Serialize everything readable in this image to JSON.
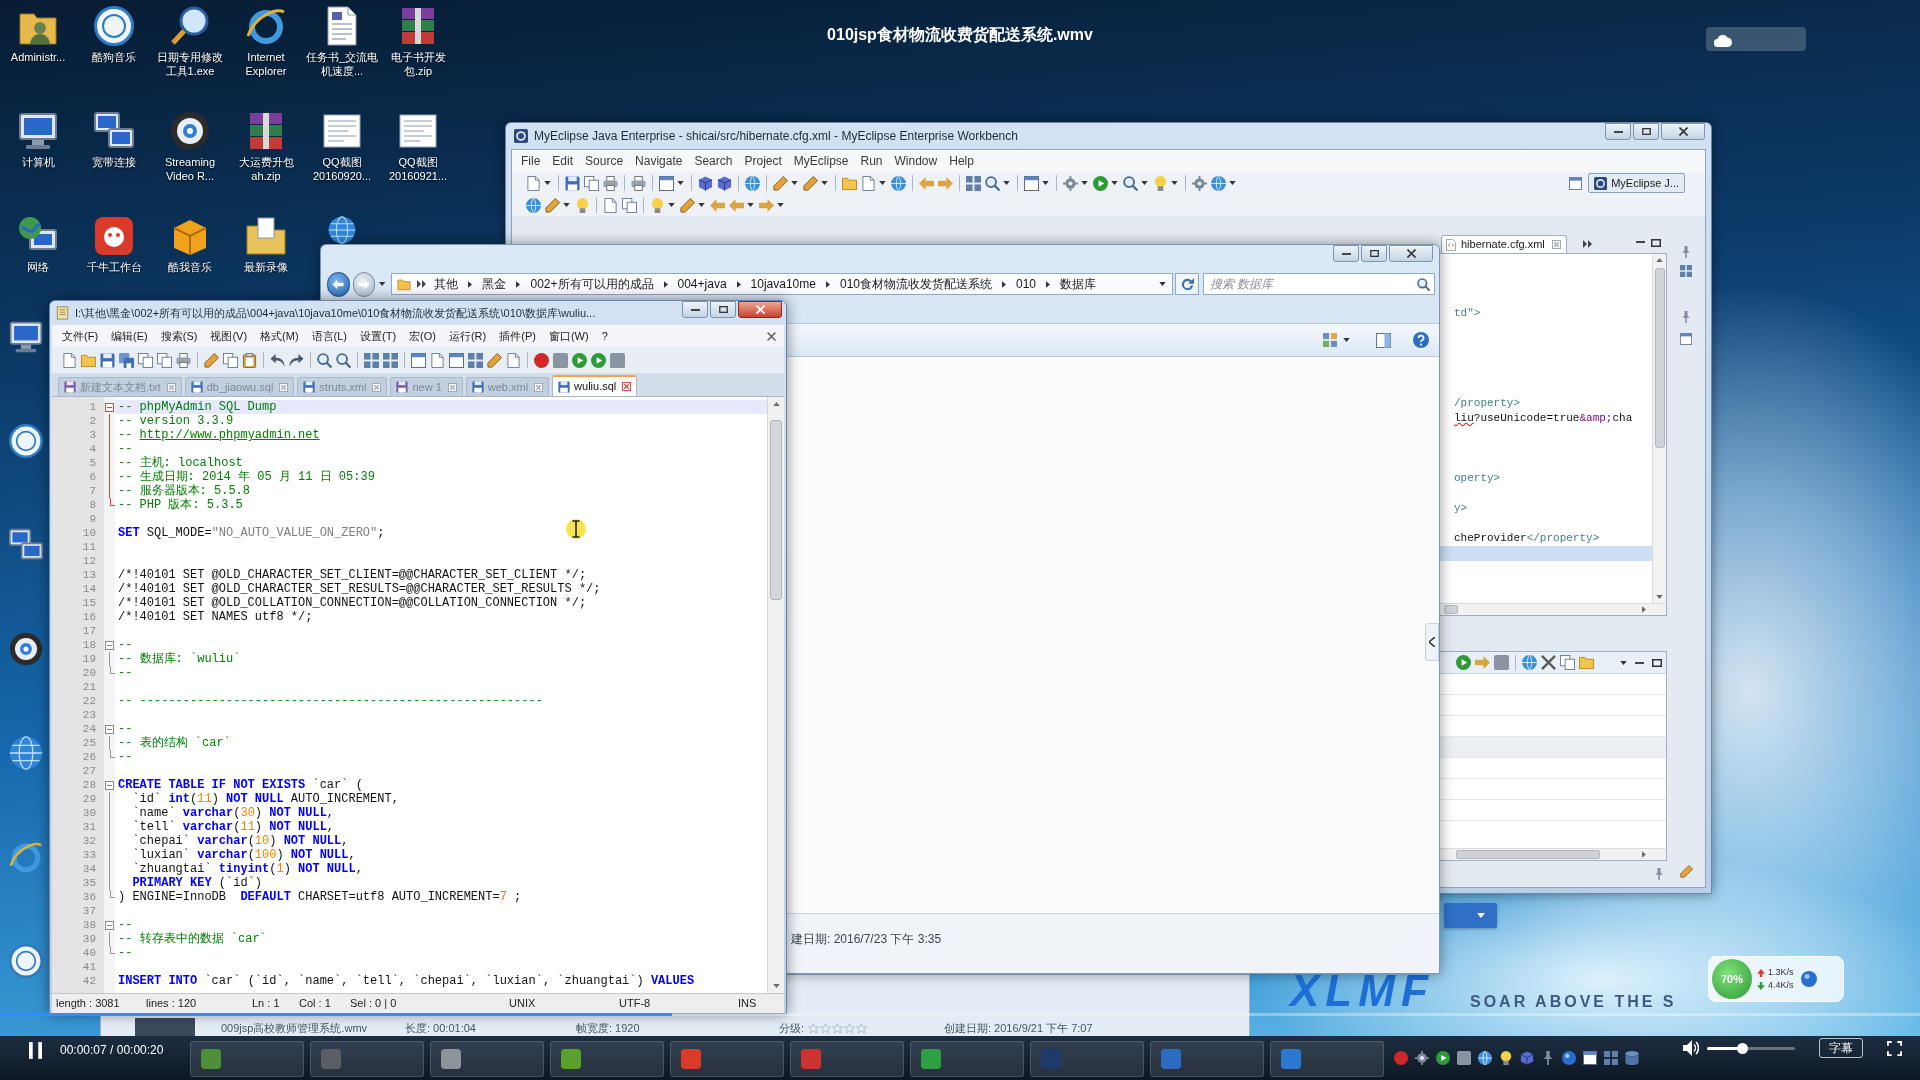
{
  "player": {
    "title": "010jsp食材物流收费货配送系统.wmv",
    "playing": true,
    "progress": {
      "level": 0.35
    },
    "time": "00:00:07 / 00:00:20",
    "volume": {
      "level": 0.4
    },
    "subtitle_button": "字幕"
  },
  "desktop_icons": [
    {
      "label": "Administr...",
      "kind": "user-folder"
    },
    {
      "label": "酷狗音乐",
      "kind": "ring"
    },
    {
      "label": "日期专用修改工具1.exe",
      "kind": "magnifier"
    },
    {
      "label": "Internet Explorer",
      "kind": "orbit"
    },
    {
      "label": "任务书_交流电机速度...",
      "kind": "document"
    },
    {
      "label": "电子书开发包.zip",
      "kind": "books"
    },
    {
      "label": "计算机",
      "kind": "monitor"
    },
    {
      "label": "宽带连接",
      "kind": "monitors"
    },
    {
      "label": "Streaming Video R...",
      "kind": "disc"
    },
    {
      "label": "大运费升包ah.zip",
      "kind": "books"
    },
    {
      "label": "QQ截图20160920...",
      "kind": "thumbnail"
    },
    {
      "label": "QQ截图20160921...",
      "kind": "thumbnail"
    },
    {
      "label": "网络",
      "kind": "globe-monitor"
    },
    {
      "label": "千牛工作台",
      "kind": "app-tile"
    },
    {
      "label": "酷我音乐",
      "kind": "box"
    },
    {
      "label": "最新录像",
      "kind": "doc-folder"
    },
    {
      "kind": "globe"
    }
  ],
  "desktop_edge_icons": [
    {
      "kind": "monitor"
    },
    {
      "kind": "ring"
    },
    {
      "kind": "monitors"
    },
    {
      "kind": "disc"
    },
    {
      "kind": "globe"
    },
    {
      "kind": "orbit"
    },
    {
      "kind": "ring"
    }
  ],
  "eclipse": {
    "title": "MyEclipse Java Enterprise - shicai/src/hibernate.cfg.xml - MyEclipse Enterprise Workbench",
    "menu": [
      "File",
      "Edit",
      "Source",
      "Navigate",
      "Search",
      "Project",
      "MyEclipse",
      "Run",
      "Window",
      "Help"
    ],
    "perspective": "MyEclipse J...",
    "editor_tab": "hibernate.cfg.xml",
    "lines": [
      {
        "current": false
      },
      {
        "current": false
      },
      {
        "current": false
      },
      {
        "current": false,
        "segments": [
          {
            "kind": "tag",
            "text": "td\">"
          }
        ]
      },
      {
        "current": false
      },
      {
        "current": false
      },
      {
        "current": false
      },
      {
        "current": false
      },
      {
        "current": false
      },
      {
        "current": false,
        "segments": [
          {
            "kind": "tag",
            "text": "/property>"
          }
        ]
      },
      {
        "current": false,
        "segments": [
          {
            "kind": "misspelled",
            "text": "liu"
          },
          {
            "kind": "plain",
            "text": "?useUnicode=true"
          },
          {
            "kind": "entity",
            "text": "&amp;"
          },
          {
            "kind": "plain",
            "text": "cha"
          }
        ]
      },
      {
        "current": false
      },
      {
        "current": false
      },
      {
        "current": false
      },
      {
        "current": false,
        "segments": [
          {
            "kind": "tag",
            "text": "operty>"
          }
        ]
      },
      {
        "current": false
      },
      {
        "current": false,
        "segments": [
          {
            "kind": "tag",
            "text": "y>"
          }
        ]
      },
      {
        "current": false
      },
      {
        "current": false,
        "segments": [
          {
            "kind": "plain",
            "text": "cheProvider"
          },
          {
            "kind": "tag",
            "text": "</property>"
          }
        ]
      },
      {
        "current": true
      },
      {
        "current": false
      },
      {
        "current": false
      },
      {
        "current": false
      }
    ]
  },
  "explorer": {
    "breadcrumb": [
      "其他",
      "黑金",
      "002+所有可以用的成品",
      "004+java",
      "10java10me",
      "010食材物流收发货配送系统",
      "010",
      "数据库"
    ],
    "search": {
      "placeholder": "搜索 数据库"
    },
    "details": "建日期: 2016/7/23 下午 3:35"
  },
  "notepad": {
    "title": "I:\\其他\\黑金\\002+所有可以用的成品\\004+java\\10java10me\\010食材物流收发货配送系统\\010\\数据库\\wuliu...",
    "menu": [
      "文件(F)",
      "编辑(E)",
      "搜索(S)",
      "视图(V)",
      "格式(M)",
      "语言(L)",
      "设置(T)",
      "宏(O)",
      "运行(R)",
      "插件(P)",
      "窗口(W)",
      "?"
    ],
    "tabs": [
      {
        "label": "新建文本文档.txt",
        "selected": false
      },
      {
        "label": "db_jiaowu.sql",
        "selected": false
      },
      {
        "label": "struts.xml",
        "selected": false
      },
      {
        "label": "new 1",
        "selected": false
      },
      {
        "label": "web.xml",
        "selected": false
      },
      {
        "label": "wuliu.sql",
        "selected": true
      }
    ],
    "lines": [
      {
        "number": "1",
        "current": true,
        "expanded": true,
        "segments": [
          {
            "kind": "comment",
            "text": "-- phpMyAdmin SQL Dump"
          }
        ],
        "children": [
          {
            "number": "2",
            "current": false,
            "segments": [
              {
                "kind": "comment",
                "text": "-- version 3.3.9"
              }
            ]
          },
          {
            "number": "3",
            "current": false,
            "segments": [
              {
                "kind": "comment",
                "text": "-- "
              },
              {
                "kind": "link",
                "text": "http://www.phpmyadmin.net"
              }
            ]
          },
          {
            "number": "4",
            "current": false,
            "segments": [
              {
                "kind": "comment",
                "text": "--"
              }
            ]
          },
          {
            "number": "5",
            "current": false,
            "segments": [
              {
                "kind": "comment",
                "text": "-- 主机: localhost"
              }
            ]
          },
          {
            "number": "6",
            "current": false,
            "segments": [
              {
                "kind": "comment",
                "text": "-- 生成日期: 2014 年 05 月 11 日 05:39"
              }
            ]
          },
          {
            "number": "7",
            "current": false,
            "segments": [
              {
                "kind": "comment",
                "text": "-- 服务器版本: 5.5.8"
              }
            ]
          },
          {
            "number": "8",
            "current": false,
            "segments": [
              {
                "kind": "comment",
                "text": "-- PHP 版本: 5.3.5"
              }
            ]
          }
        ]
      },
      {
        "number": "9",
        "current": false
      },
      {
        "number": "10",
        "current": false,
        "segments": [
          {
            "kind": "keyword",
            "text": "SET"
          },
          {
            "kind": "plain",
            "text": " SQL_MODE="
          },
          {
            "kind": "string",
            "text": "\"NO_AUTO_VALUE_ON_ZERO\""
          },
          {
            "kind": "plain",
            "text": ";"
          }
        ]
      },
      {
        "number": "11",
        "current": false
      },
      {
        "number": "12",
        "current": false
      },
      {
        "number": "13",
        "current": false,
        "segments": [
          {
            "kind": "plain",
            "text": "/*!40101 SET @OLD_CHARACTER_SET_CLIENT=@@CHARACTER_SET_CLIENT */;"
          }
        ]
      },
      {
        "number": "14",
        "current": false,
        "segments": [
          {
            "kind": "plain",
            "text": "/*!40101 SET @OLD_CHARACTER_SET_RESULTS=@@CHARACTER_SET_RESULTS */;"
          }
        ]
      },
      {
        "number": "15",
        "current": false,
        "segments": [
          {
            "kind": "plain",
            "text": "/*!40101 SET @OLD_COLLATION_CONNECTION=@@COLLATION_CONNECTION */;"
          }
        ]
      },
      {
        "number": "16",
        "current": false,
        "segments": [
          {
            "kind": "plain",
            "text": "/*!40101 SET NAMES utf8 */;"
          }
        ]
      },
      {
        "number": "17",
        "current": false
      },
      {
        "number": "18",
        "current": false,
        "expanded": true,
        "segments": [
          {
            "kind": "comment",
            "text": "--"
          }
        ],
        "children": [
          {
            "number": "19",
            "current": false,
            "segments": [
              {
                "kind": "comment",
                "text": "-- 数据库: `wuliu`"
              }
            ]
          },
          {
            "number": "20",
            "current": false,
            "segments": [
              {
                "kind": "comment",
                "text": "--"
              }
            ]
          }
        ]
      },
      {
        "number": "21",
        "current": false
      },
      {
        "number": "22",
        "current": false,
        "segments": [
          {
            "kind": "comment",
            "text": "-- --------------------------------------------------------"
          }
        ]
      },
      {
        "number": "23",
        "current": false
      },
      {
        "number": "24",
        "current": false,
        "expanded": true,
        "segments": [
          {
            "kind": "comment",
            "text": "--"
          }
        ],
        "children": [
          {
            "number": "25",
            "current": false,
            "segments": [
              {
                "kind": "comment",
                "text": "-- 表的结构 `car`"
              }
            ]
          },
          {
            "number": "26",
            "current": false,
            "segments": [
              {
                "kind": "comment",
                "text": "--"
              }
            ]
          }
        ]
      },
      {
        "number": "27",
        "current": false
      },
      {
        "number": "28",
        "current": false,
        "expanded": true,
        "segments": [
          {
            "kind": "keyword",
            "text": "CREATE TABLE IF NOT EXISTS"
          },
          {
            "kind": "plain",
            "text": " `car` ("
          }
        ],
        "children": [
          {
            "number": "29",
            "current": false,
            "segments": [
              {
                "kind": "plain",
                "text": "  `id` "
              },
              {
                "kind": "keyword",
                "text": "int"
              },
              {
                "kind": "plain",
                "text": "("
              },
              {
                "kind": "number",
                "text": "11"
              },
              {
                "kind": "plain",
                "text": ") "
              },
              {
                "kind": "keyword",
                "text": "NOT NULL"
              },
              {
                "kind": "plain",
                "text": " AUTO_INCREMENT,"
              }
            ]
          },
          {
            "number": "30",
            "current": false,
            "segments": [
              {
                "kind": "plain",
                "text": "  `name` "
              },
              {
                "kind": "keyword",
                "text": "varchar"
              },
              {
                "kind": "plain",
                "text": "("
              },
              {
                "kind": "number",
                "text": "30"
              },
              {
                "kind": "plain",
                "text": ") "
              },
              {
                "kind": "keyword",
                "text": "NOT NULL"
              },
              {
                "kind": "plain",
                "text": ","
              }
            ]
          },
          {
            "number": "31",
            "current": false,
            "segments": [
              {
                "kind": "plain",
                "text": "  `tell` "
              },
              {
                "kind": "keyword",
                "text": "varchar"
              },
              {
                "kind": "plain",
                "text": "("
              },
              {
                "kind": "number",
                "text": "11"
              },
              {
                "kind": "plain",
                "text": ") "
              },
              {
                "kind": "keyword",
                "text": "NOT NULL"
              },
              {
                "kind": "plain",
                "text": ","
              }
            ]
          },
          {
            "number": "32",
            "current": false,
            "segments": [
              {
                "kind": "plain",
                "text": "  `chepai` "
              },
              {
                "kind": "keyword",
                "text": "varchar"
              },
              {
                "kind": "plain",
                "text": "("
              },
              {
                "kind": "number",
                "text": "10"
              },
              {
                "kind": "plain",
                "text": ") "
              },
              {
                "kind": "keyword",
                "text": "NOT NULL"
              },
              {
                "kind": "plain",
                "text": ","
              }
            ]
          },
          {
            "number": "33",
            "current": false,
            "segments": [
              {
                "kind": "plain",
                "text": "  `luxian` "
              },
              {
                "kind": "keyword",
                "text": "varchar"
              },
              {
                "kind": "plain",
                "text": "("
              },
              {
                "kind": "number",
                "text": "100"
              },
              {
                "kind": "plain",
                "text": ") "
              },
              {
                "kind": "keyword",
                "text": "NOT NULL"
              },
              {
                "kind": "plain",
                "text": ","
              }
            ]
          },
          {
            "number": "34",
            "current": false,
            "segments": [
              {
                "kind": "plain",
                "text": "  `zhuangtai` "
              },
              {
                "kind": "keyword",
                "text": "tinyint"
              },
              {
                "kind": "plain",
                "text": "("
              },
              {
                "kind": "number",
                "text": "1"
              },
              {
                "kind": "plain",
                "text": ") "
              },
              {
                "kind": "keyword",
                "text": "NOT NULL"
              },
              {
                "kind": "plain",
                "text": ","
              }
            ]
          },
          {
            "number": "35",
            "current": false,
            "segments": [
              {
                "kind": "keyword",
                "text": "  PRIMARY KEY"
              },
              {
                "kind": "plain",
                "text": " (`id`)"
              }
            ]
          },
          {
            "number": "36",
            "current": false,
            "segments": [
              {
                "kind": "plain",
                "text": ") ENGINE=InnoDB  "
              },
              {
                "kind": "keyword",
                "text": "DEFAULT"
              },
              {
                "kind": "plain",
                "text": " CHARSET=utf8 AUTO_INCREMENT="
              },
              {
                "kind": "number",
                "text": "7"
              },
              {
                "kind": "plain",
                "text": " ;"
              }
            ]
          }
        ]
      },
      {
        "number": "37",
        "current": false
      },
      {
        "number": "38",
        "current": false,
        "expanded": true,
        "segments": [
          {
            "kind": "comment",
            "text": "--"
          }
        ],
        "children": [
          {
            "number": "39",
            "current": false,
            "segments": [
              {
                "kind": "comment",
                "text": "-- 转存表中的数据 `car`"
              }
            ]
          },
          {
            "number": "40",
            "current": false,
            "segments": [
              {
                "kind": "comment",
                "text": "--"
              }
            ]
          }
        ]
      },
      {
        "number": "41",
        "current": false
      },
      {
        "number": "42",
        "current": false,
        "segments": [
          {
            "kind": "keyword",
            "text": "INSERT INTO"
          },
          {
            "kind": "plain",
            "text": " `car` (`id`, `name`, `tell`, `chepai`, `luxian`, `zhuangtai`) "
          },
          {
            "kind": "keyword",
            "text": "VALUES"
          }
        ]
      }
    ],
    "status": [
      "length : 3081",
      "lines : 120",
      "Ln : 1",
      "Col : 1",
      "Sel : 0 | 0",
      "UNIX",
      "UTF-8",
      "INS"
    ]
  },
  "background_window": {
    "file_name": "009jsp高校教师管理系统.wmv",
    "length": "长度: 00:01:04",
    "frame_width": "帧宽度: 1920",
    "rating_label": "分级:",
    "rating": {
      "stars": 0
    },
    "created": "创建日期: 2016/9/21 下午 7:07"
  },
  "taskbar": {
    "buttons": [
      {
        "color": "#4f8f3a"
      },
      {
        "color": "#5a5f66"
      },
      {
        "color": "#8d949c"
      },
      {
        "color": "#5aa02c"
      },
      {
        "color": "#d93a2a"
      },
      {
        "color": "#cc3333"
      },
      {
        "color": "#2ea043"
      },
      {
        "color": "#1d3a6a"
      },
      {
        "color": "#2d6cc0"
      },
      {
        "color": "#2b78d0"
      }
    ]
  },
  "net_monitor": {
    "usage": "70%",
    "upload": "1.3K/s",
    "download": "4.4K/s"
  },
  "logo": {
    "mark": "XLMF",
    "slogan": "SOAR ABOVE THE S"
  }
}
